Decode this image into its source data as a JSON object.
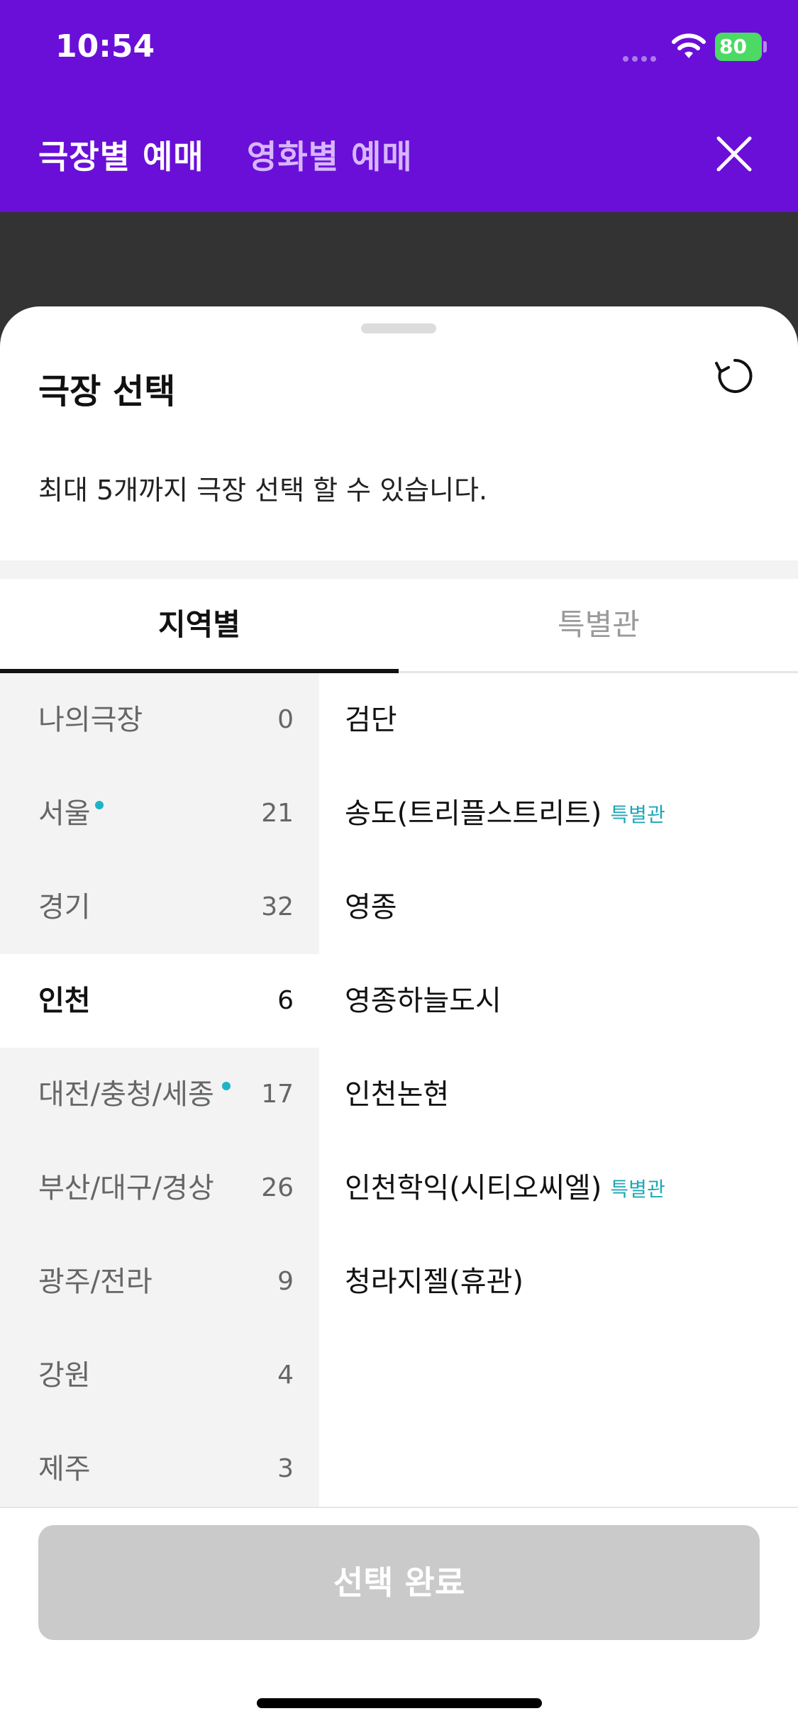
{
  "status_bar": {
    "time": "10:54",
    "battery": "80"
  },
  "header": {
    "tabs": [
      {
        "label": "극장별 예매"
      },
      {
        "label": "영화별 예매"
      }
    ]
  },
  "sheet": {
    "title": "극장 선택",
    "subtitle": "최대 5개까지 극장 선택 할 수 있습니다.",
    "tabs": [
      {
        "label": "지역별"
      },
      {
        "label": "특별관"
      }
    ],
    "regions": [
      {
        "name": "나의극장",
        "count": "0"
      },
      {
        "name": "서울",
        "count": "21"
      },
      {
        "name": "경기",
        "count": "32"
      },
      {
        "name": "인천",
        "count": "6"
      },
      {
        "name": "대전/충청/세종",
        "count": "17"
      },
      {
        "name": "부산/대구/경상",
        "count": "26"
      },
      {
        "name": "광주/전라",
        "count": "9"
      },
      {
        "name": "강원",
        "count": "4"
      },
      {
        "name": "제주",
        "count": "3"
      }
    ],
    "theaters": [
      {
        "name": "검단"
      },
      {
        "name": "송도(트리플스트리트)",
        "badge": "특별관"
      },
      {
        "name": "영종"
      },
      {
        "name": "영종하늘도시"
      },
      {
        "name": "인천논현"
      },
      {
        "name": "인천학익(시티오씨엘)",
        "badge": "특별관"
      },
      {
        "name": "청라지젤(휴관)"
      }
    ],
    "confirm_label": "선택 완료"
  },
  "colors": {
    "brand": "#6a0fd8",
    "inactive_tab": "#d7b6ff",
    "badge": "#1fa7b8",
    "new_dot": "#1eb4c8",
    "disabled_button": "#cacaca"
  }
}
